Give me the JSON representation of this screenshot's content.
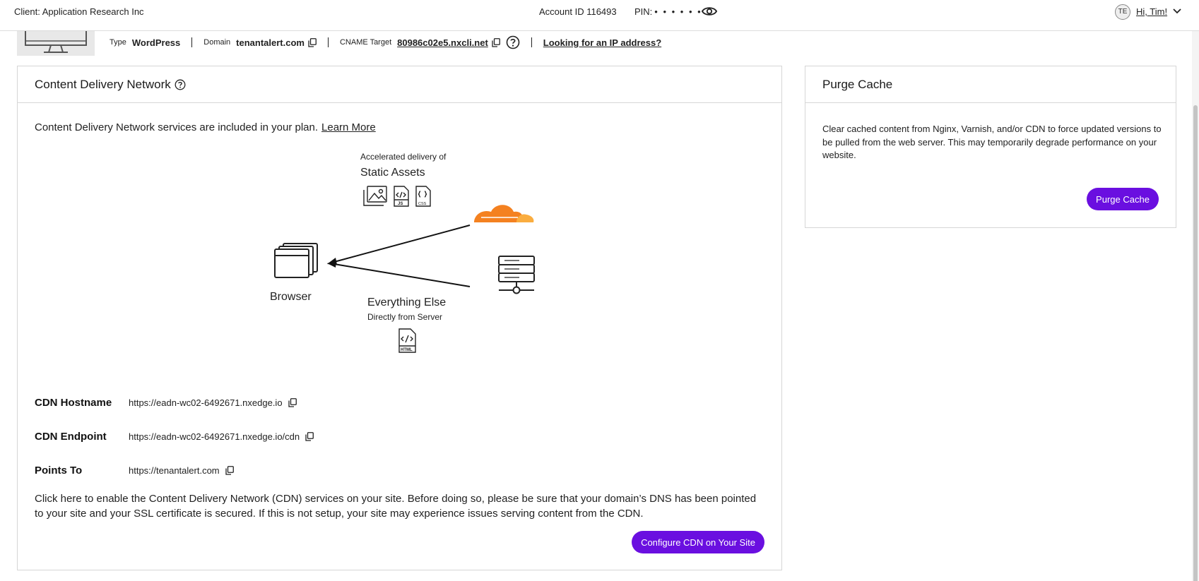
{
  "header": {
    "client": "Client: Application Research Inc",
    "account": "Account ID 116493",
    "pin_label": "PIN:",
    "pin_mask": "• • • • • •",
    "avatar_initials": "TE",
    "greeting": "Hi, Tim!"
  },
  "site": {
    "type_label": "Type",
    "type_value": "WordPress",
    "domain_label": "Domain",
    "domain_value": "tenantalert.com",
    "cname_label": "CNAME Target",
    "cname_value": "80986c02e5.nxcli.net",
    "ip_link": "Looking for an IP address?"
  },
  "cdn": {
    "title": "Content Delivery Network",
    "intro": "Content Delivery Network services are included in your plan.",
    "learn_more": "Learn More",
    "diagram": {
      "accel_caption": "Accelerated delivery of",
      "static_assets": "Static Assets",
      "browser_label": "Browser",
      "everything_else": "Everything Else",
      "directly_from_server": "Directly from Server",
      "js_tag": "JS",
      "css_tag": "CSS",
      "html_tag": "HTML"
    },
    "fields": [
      {
        "label": "CDN Hostname",
        "value": "https://eadn-wc02-6492671.nxedge.io"
      },
      {
        "label": "CDN Endpoint",
        "value": "https://eadn-wc02-6492671.nxedge.io/cdn"
      },
      {
        "label": "Points To",
        "value": "https://tenantalert.com"
      }
    ],
    "description": "Click here to enable the Content Delivery Network (CDN) services on your site. Before doing so, please be sure that your domain’s DNS has been pointed to your site and your SSL certificate is secured. If this is not setup, your site may experience issues serving content from the CDN.",
    "configure_button": "Configure CDN on Your Site"
  },
  "purge": {
    "title": "Purge Cache",
    "description": "Clear cached content from Nginx, Varnish, and/or CDN to force updated versions to be pulled from the web server. This may temporarily degrade performance on your website.",
    "button": "Purge Cache"
  },
  "colors": {
    "accent": "#6a0fe0",
    "cloud_orange": "#f48120",
    "cloud_light": "#faad3f"
  }
}
